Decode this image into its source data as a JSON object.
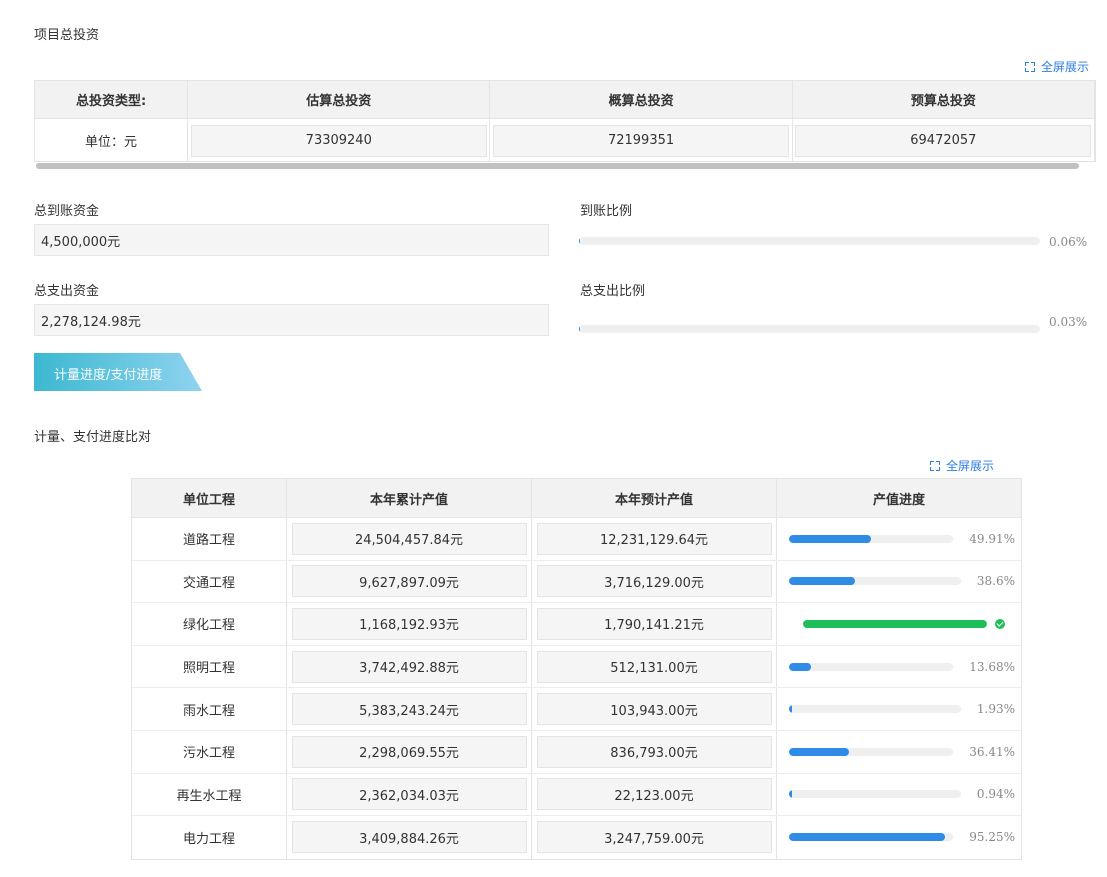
{
  "investment": {
    "title": "项目总投资",
    "fullscreen_label": "全屏展示",
    "headers": [
      "总投资类型:",
      "估算总投资",
      "概算总投资",
      "预算总投资"
    ],
    "unit_label": "单位：元",
    "values": [
      "73309240",
      "72199351",
      "69472057"
    ]
  },
  "funds": {
    "received_label": "总到账资金",
    "received_value": "4,500,000元",
    "received_ratio_label": "到账比例",
    "received_ratio_text": "0.06%",
    "received_ratio": 0.06,
    "spent_label": "总支出资金",
    "spent_value": "2,278,124.98元",
    "spent_ratio_label": "总支出比例",
    "spent_ratio_text": "0.03%",
    "spent_ratio": 0.03
  },
  "tab": {
    "label": "计量进度/支付进度"
  },
  "comparison": {
    "title": "计量、支付进度比对",
    "fullscreen_label": "全屏展示",
    "headers": [
      "单位工程",
      "本年累计产值",
      "本年预计产值",
      "产值进度"
    ],
    "rows": [
      {
        "name": "道路工程",
        "actual": "24,504,457.84元",
        "planned": "12,231,129.64元",
        "progress_text": "49.91%",
        "progress": 49.91,
        "complete": false
      },
      {
        "name": "交通工程",
        "actual": "9,627,897.09元",
        "planned": "3,716,129.00元",
        "progress_text": "38.6%",
        "progress": 38.6,
        "complete": false
      },
      {
        "name": "绿化工程",
        "actual": "1,168,192.93元",
        "planned": "1,790,141.21元",
        "progress_text": "",
        "progress": 100,
        "complete": true
      },
      {
        "name": "照明工程",
        "actual": "3,742,492.88元",
        "planned": "512,131.00元",
        "progress_text": "13.68%",
        "progress": 13.68,
        "complete": false
      },
      {
        "name": "雨水工程",
        "actual": "5,383,243.24元",
        "planned": "103,943.00元",
        "progress_text": "1.93%",
        "progress": 1.93,
        "complete": false
      },
      {
        "name": "污水工程",
        "actual": "2,298,069.55元",
        "planned": "836,793.00元",
        "progress_text": "36.41%",
        "progress": 36.41,
        "complete": false
      },
      {
        "name": "再生水工程",
        "actual": "2,362,034.03元",
        "planned": "22,123.00元",
        "progress_text": "0.94%",
        "progress": 0.94,
        "complete": false
      },
      {
        "name": "电力工程",
        "actual": "3,409,884.26元",
        "planned": "3,247,759.00元",
        "progress_text": "95.25%",
        "progress": 95.25,
        "complete": false
      }
    ]
  },
  "colors": {
    "accent": "#2f8be6",
    "complete": "#1dbd5a",
    "link": "#2f7ee0",
    "tab_start": "#3cb8d0",
    "tab_end": "#8fd3f0"
  }
}
